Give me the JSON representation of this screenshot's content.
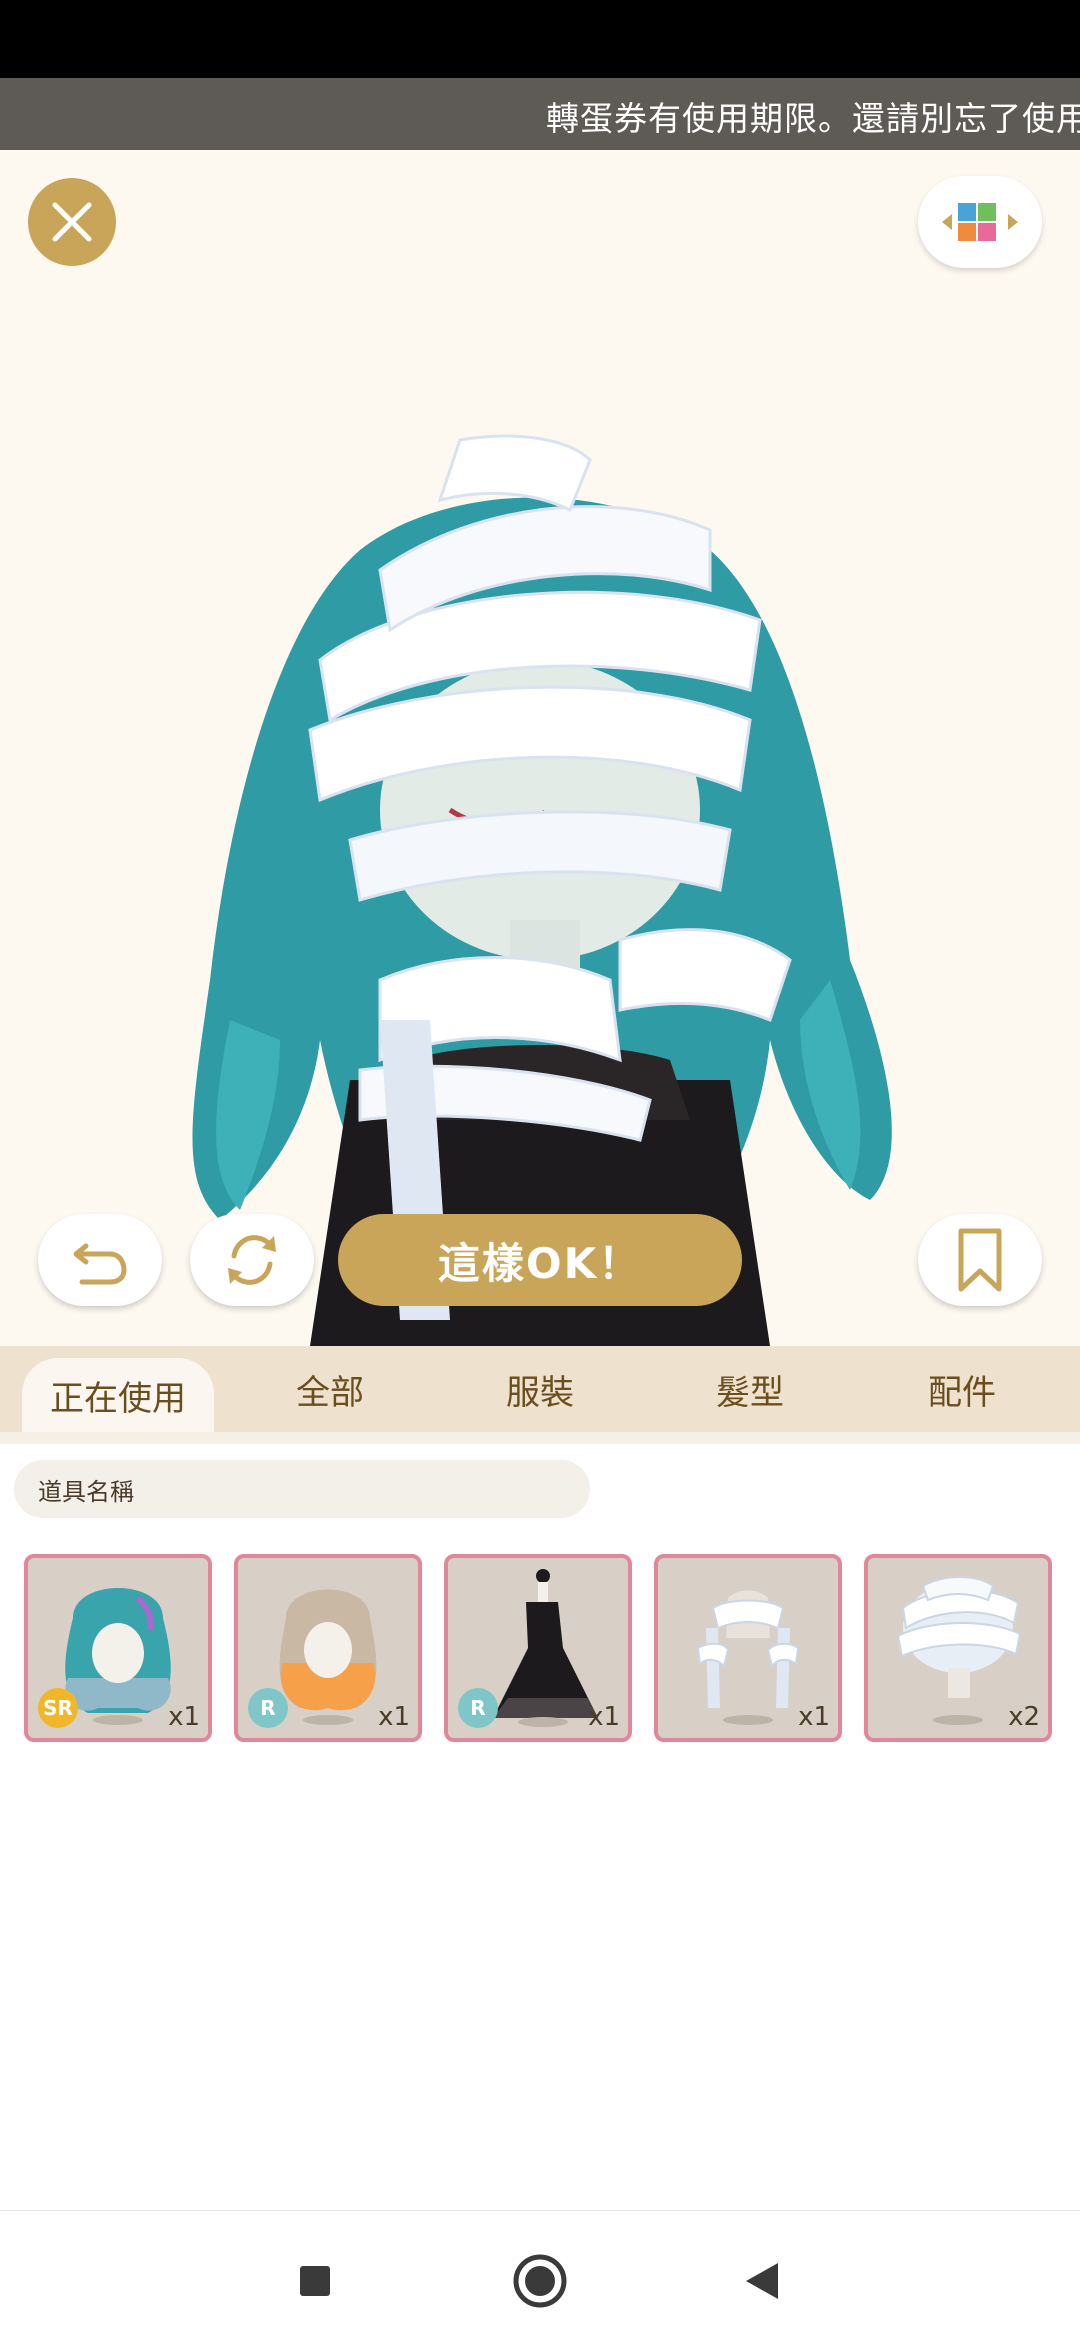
{
  "ticker": {
    "text": "轉蛋券有使用期限。還請別忘了使用"
  },
  "toolbar": {
    "ok_label": "這樣OK！"
  },
  "tabs": [
    {
      "label": "正在使用",
      "active": true
    },
    {
      "label": "全部",
      "active": false
    },
    {
      "label": "服裝",
      "active": false
    },
    {
      "label": "髮型",
      "active": false
    },
    {
      "label": "配件",
      "active": false
    }
  ],
  "search": {
    "placeholder": "道具名稱"
  },
  "items": [
    {
      "rarity": "SR",
      "count": "x1",
      "icon": "teal-wavy-hair-icon",
      "rarity_color": "#f0b72b"
    },
    {
      "rarity": "R",
      "count": "x1",
      "icon": "orange-wavy-hair-icon",
      "rarity_color": "#7ec6c8"
    },
    {
      "rarity": "R",
      "count": "x1",
      "icon": "black-dress-icon",
      "rarity_color": "#7ec6c8"
    },
    {
      "rarity": "",
      "count": "x1",
      "icon": "bandage-arms-icon",
      "rarity_color": ""
    },
    {
      "rarity": "",
      "count": "x2",
      "icon": "bandage-head-icon",
      "rarity_color": ""
    }
  ],
  "colors": {
    "accent": "#c9a55a",
    "item_border": "#e0889a",
    "tab_bg": "#eee2cf"
  }
}
